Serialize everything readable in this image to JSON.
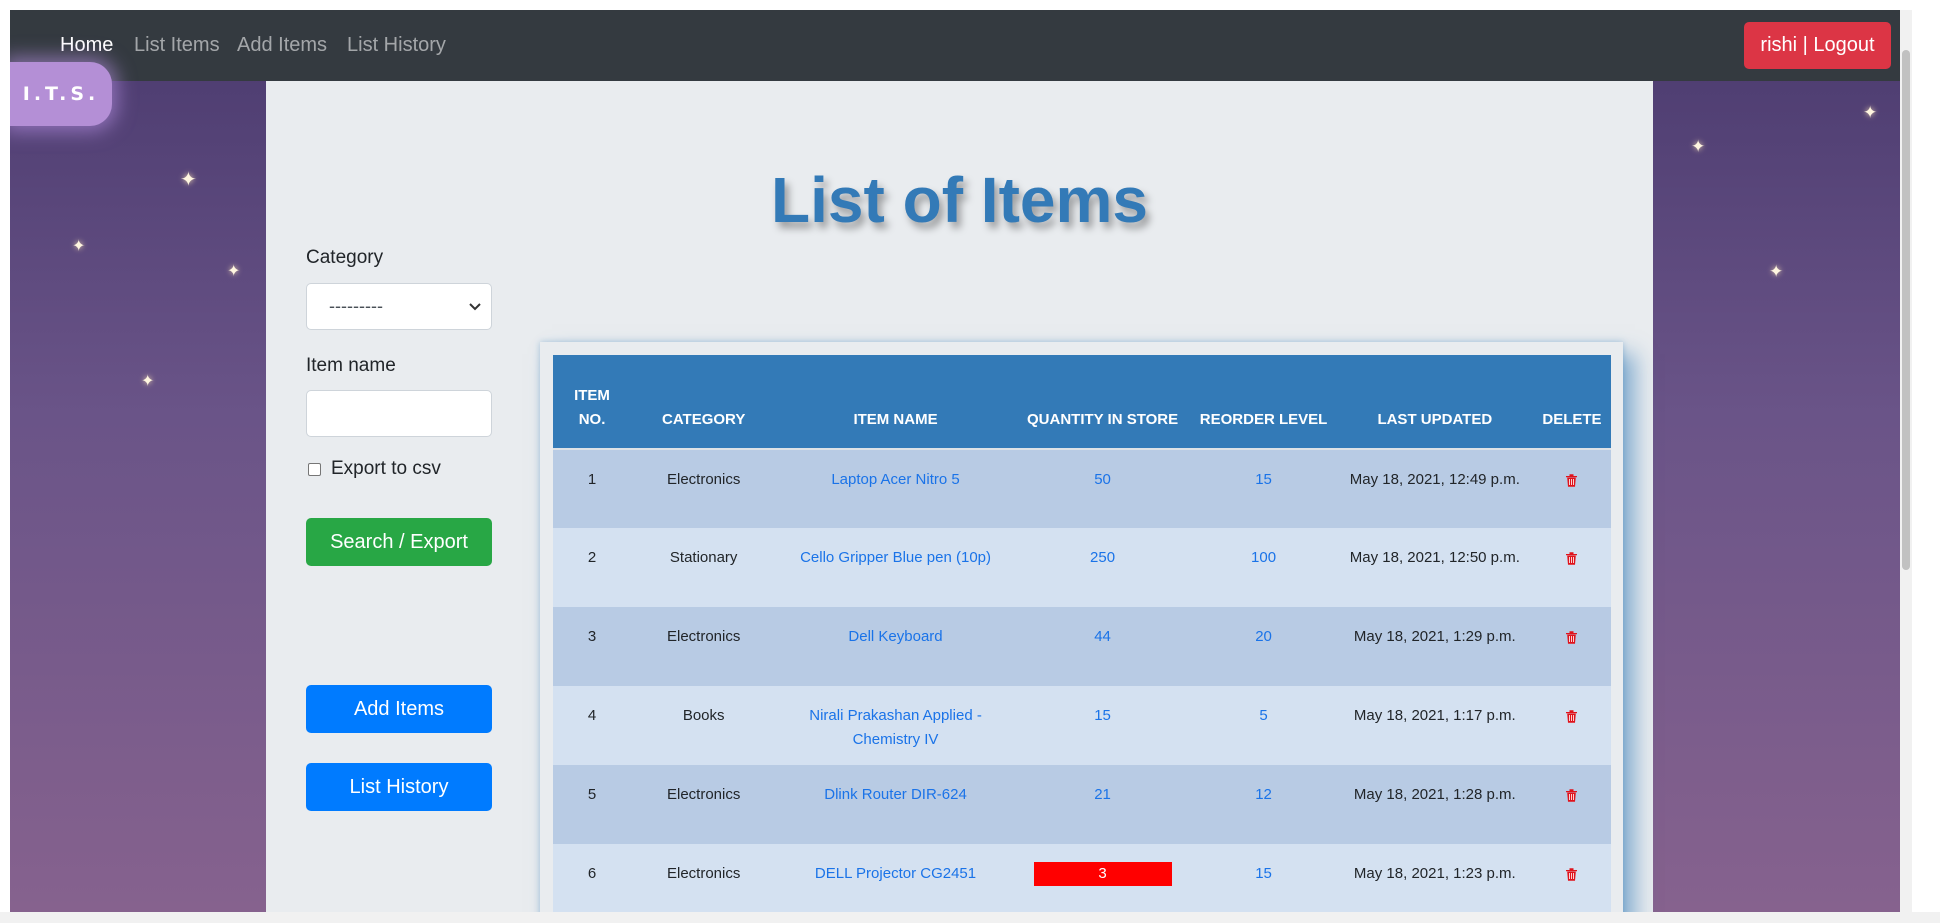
{
  "nav": {
    "home": "Home",
    "list_items": "List Items",
    "add_items": "Add Items",
    "list_history": "List History",
    "logout": "rishi | Logout"
  },
  "logo": "I.T.S.",
  "page_title": "List of Items",
  "filters": {
    "category_label": "Category",
    "category_selected": "---------",
    "item_name_label": "Item name",
    "item_name_value": "",
    "export_label": "Export to csv",
    "search_button": "Search / Export"
  },
  "side_buttons": {
    "add_items": "Add Items",
    "list_history": "List History"
  },
  "table": {
    "headers": [
      "Item No.",
      "Category",
      "Item Name",
      "Quantity In Store",
      "Reorder Level",
      "Last Updated",
      "Delete"
    ],
    "rows": [
      {
        "no": "1",
        "category": "Electronics",
        "name": "Laptop Acer Nitro 5",
        "qty": "50",
        "reorder": "15",
        "updated": "May 18, 2021, 12:49 p.m.",
        "low": false
      },
      {
        "no": "2",
        "category": "Stationary",
        "name": "Cello Gripper Blue pen (10p)",
        "qty": "250",
        "reorder": "100",
        "updated": "May 18, 2021, 12:50 p.m.",
        "low": false
      },
      {
        "no": "3",
        "category": "Electronics",
        "name": "Dell Keyboard",
        "qty": "44",
        "reorder": "20",
        "updated": "May 18, 2021, 1:29 p.m.",
        "low": false
      },
      {
        "no": "4",
        "category": "Books",
        "name": "Nirali Prakashan Applied - Chemistry IV",
        "qty": "15",
        "reorder": "5",
        "updated": "May 18, 2021, 1:17 p.m.",
        "low": false
      },
      {
        "no": "5",
        "category": "Electronics",
        "name": "Dlink Router DIR-624",
        "qty": "21",
        "reorder": "12",
        "updated": "May 18, 2021, 1:28 p.m.",
        "low": false
      },
      {
        "no": "6",
        "category": "Electronics",
        "name": "DELL Projector CG2451",
        "qty": "3",
        "reorder": "15",
        "updated": "May 18, 2021, 1:23 p.m.",
        "low": true
      }
    ]
  },
  "colors": {
    "navbar": "#343a40",
    "danger": "#dc3545",
    "success": "#28a745",
    "primary": "#007bff",
    "table_header": "#337ab7",
    "low_stock": "#ff0000"
  }
}
